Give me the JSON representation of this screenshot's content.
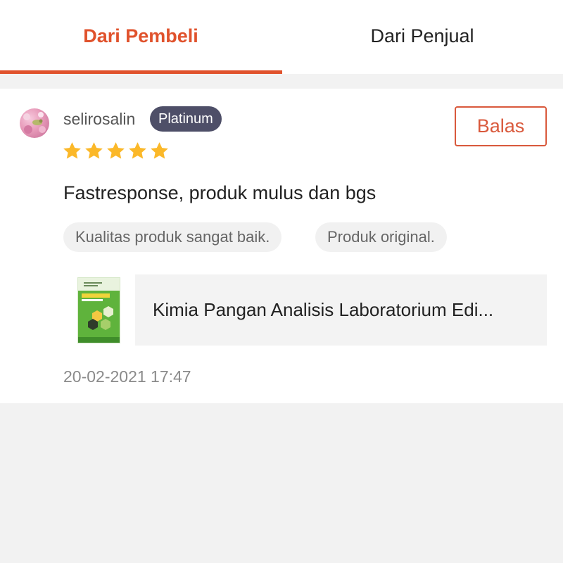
{
  "tabs": [
    {
      "label": "Dari Pembeli",
      "active": true
    },
    {
      "label": "Dari Penjual",
      "active": false
    }
  ],
  "colors": {
    "accent": "#e0522c",
    "badge": "#4e4f68",
    "star": "#fbb829",
    "tag_bg": "#f1f1f1"
  },
  "review": {
    "username": "selirosalin",
    "badge": "Platinum",
    "reply_label": "Balas",
    "rating": 5,
    "rating_max": 5,
    "text": "Fastresponse, produk mulus dan bgs",
    "tags": [
      "Kualitas produk sangat baik.",
      "Produk original."
    ],
    "product": {
      "title": "Kimia Pangan Analisis Laboratorium Edi...",
      "thumbnail": "book-cover-thumbnail"
    },
    "timestamp": "20-02-2021 17:47"
  }
}
